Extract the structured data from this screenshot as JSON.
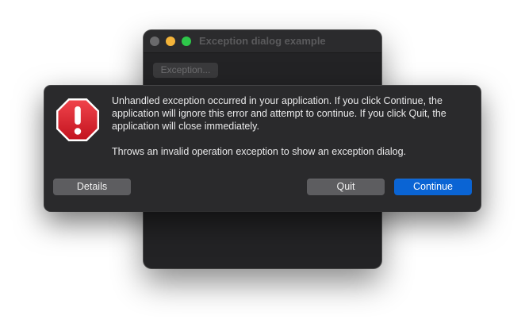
{
  "window": {
    "title": "Exception dialog example",
    "exception_button_label": "Exception..."
  },
  "dialog": {
    "icon": "stop-exclamation-icon",
    "message": "Unhandled exception occurred in your application. If you click Continue, the application will ignore this error and attempt to continue. If you click Quit, the application will close immediately.",
    "detail": "Throws an invalid operation exception to show an exception dialog.",
    "buttons": {
      "details": "Details",
      "quit": "Quit",
      "continue": "Continue"
    }
  },
  "colors": {
    "accent": "#0a64d4",
    "stop_icon": "#d9232e",
    "traffic_close": "#6a6a6c",
    "traffic_minimize": "#f4b43a",
    "traffic_maximize": "#2ec74a"
  }
}
